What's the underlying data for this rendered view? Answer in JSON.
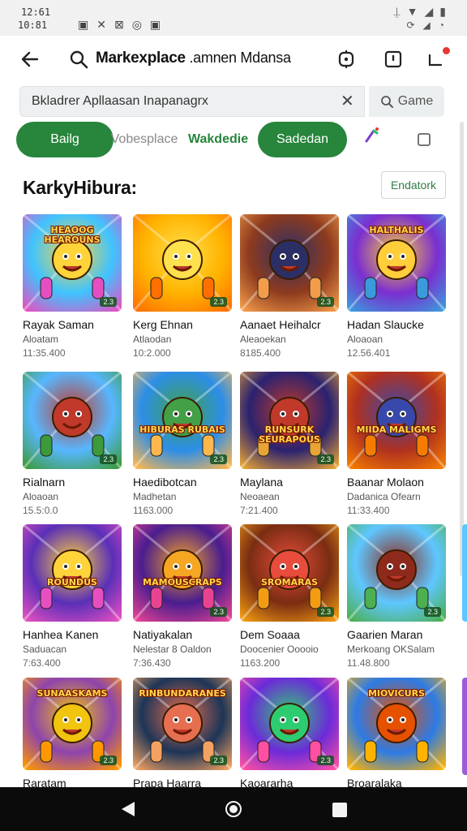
{
  "status": {
    "time_top": "12:61",
    "time_bottom": "10:81"
  },
  "appbar": {
    "title": "Markexplace",
    "title_sub": " .amnen Mdansa"
  },
  "search": {
    "value": "Bkladrer Apllaasan Inapanagrx",
    "button_label": "Game"
  },
  "chips": [
    {
      "label": "Bailg"
    },
    {
      "label": "Vobesplace"
    },
    {
      "label": "Wakdedie"
    },
    {
      "label": "Sadedan"
    }
  ],
  "section": {
    "title": "KarkyHibura:",
    "button_label": "Endatork"
  },
  "games": [
    {
      "title": "Rayak Saman",
      "dev": "Aloatam",
      "count": "11:35.400",
      "banner": "HEAOOG HEAROUNS",
      "tag": "2.3"
    },
    {
      "title": "Kerg Ehnan",
      "dev": "Atlaodan",
      "count": "10:2.000",
      "banner": "",
      "tag": "2.3"
    },
    {
      "title": "Aanaet Heihalcr",
      "dev": "Aleaoekan",
      "count": "8185.400",
      "banner": "",
      "tag": "2.3"
    },
    {
      "title": "Hadan Slaucke",
      "dev": "Aloaoan",
      "count": "12.56.401",
      "banner": "HALTHALIS",
      "tag": ""
    },
    {
      "title": "Rialnarn",
      "dev": "Aloaoan",
      "count": "15.5:0.0",
      "banner": "",
      "tag": "2.3"
    },
    {
      "title": "Haedibotcan",
      "dev": "Madhetan",
      "count": "1163.000",
      "banner": "HIBURAS RUBAIS",
      "tag": "2.3"
    },
    {
      "title": "Maylana",
      "dev": "Neoaean",
      "count": "7:21.400",
      "banner": "RUNSURK SEURAPOUS",
      "tag": "2.3"
    },
    {
      "title": "Baanar Molaon",
      "dev": "Dadanica Ofearn",
      "count": "11:33.400",
      "banner": "MIIDA MALIGMS",
      "tag": ""
    },
    {
      "title": "Hanhea Kanen",
      "dev": "Saduacan",
      "count": "7:63.400",
      "banner": "ROUNDUS",
      "tag": ""
    },
    {
      "title": "Natiyakalan",
      "dev": "Nelestar 8 Oaldon",
      "count": "7:36.430",
      "banner": "MAMOUSCRAPS",
      "tag": "2.3"
    },
    {
      "title": "Dem Soaaa",
      "dev": "Doocenier Ooooio",
      "count": "1163.200",
      "banner": "SROMARAS",
      "tag": "2.3"
    },
    {
      "title": "Gaarien Maran",
      "dev": "Merkoang OKSalam",
      "count": "11.48.800",
      "banner": "",
      "tag": "2.3"
    },
    {
      "title": "Raratam",
      "dev": "",
      "count": "",
      "banner": "SUNAASKAMS",
      "tag": "2.3"
    },
    {
      "title": "Prapa Haarra",
      "dev": "",
      "count": "",
      "banner": "RINBUNDARANES",
      "tag": "2.3"
    },
    {
      "title": "Kaoararha",
      "dev": "",
      "count": "",
      "banner": "",
      "tag": "2.3"
    },
    {
      "title": "Broaralaka",
      "dev": "",
      "count": "",
      "banner": "MIOVICURS",
      "tag": ""
    }
  ],
  "colors": {
    "accent_green": "#27853c",
    "badge_red": "#e53935"
  }
}
